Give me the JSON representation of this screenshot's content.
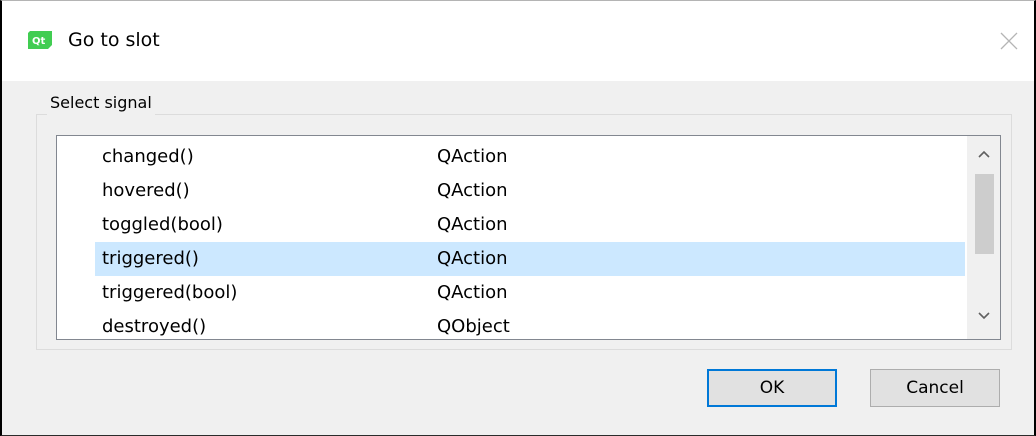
{
  "window": {
    "title": "Go to slot",
    "app_icon": "qt-icon",
    "close_icon": "close-icon"
  },
  "group": {
    "title": "Select signal"
  },
  "signals": [
    {
      "signal": "changed()",
      "class": "QAction",
      "selected": false
    },
    {
      "signal": "hovered()",
      "class": "QAction",
      "selected": false
    },
    {
      "signal": "toggled(bool)",
      "class": "QAction",
      "selected": false
    },
    {
      "signal": "triggered()",
      "class": "QAction",
      "selected": true
    },
    {
      "signal": "triggered(bool)",
      "class": "QAction",
      "selected": false
    },
    {
      "signal": "destroyed()",
      "class": "QObject",
      "selected": false
    }
  ],
  "buttons": {
    "ok": "OK",
    "cancel": "Cancel"
  },
  "colors": {
    "selection": "#cce8ff",
    "default_button_border": "#0078d7",
    "qt_green": "#41cd52"
  }
}
